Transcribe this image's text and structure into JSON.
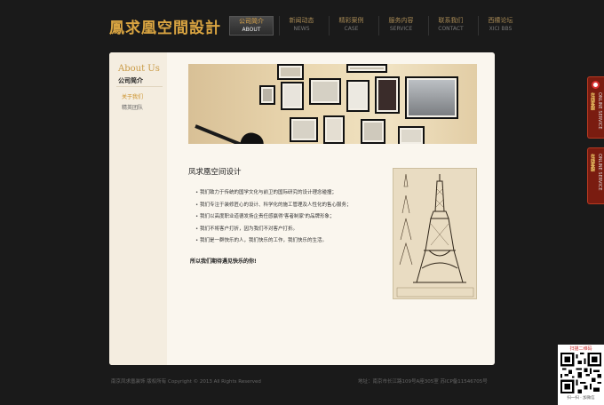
{
  "header": {
    "logo": "鳳求凰空間設計",
    "nav": [
      {
        "cn": "公司简介",
        "en": "ABOUT",
        "active": true
      },
      {
        "cn": "新闻动态",
        "en": "NEWS"
      },
      {
        "cn": "精彩案例",
        "en": "CASE"
      },
      {
        "cn": "服务内容",
        "en": "SERVICE"
      },
      {
        "cn": "联系我们",
        "en": "CONTACT"
      },
      {
        "cn": "西檬论坛",
        "en": "XICI BBS"
      }
    ]
  },
  "sidebar": {
    "title": "About Us",
    "subtitle": "公司简介",
    "links": [
      "关于我们",
      "精英团队"
    ]
  },
  "content": {
    "title": "凤求凰空间设计",
    "bullets": [
      "我们致力于传统的国学文化与前卫的国际研究的设计理念碰撞；",
      "我们专注于装修匠心的设计、科学化的施工管理及人性化的售心服务；",
      "我们以高度职业道德发扬企责任感赢得'客者制家'的品牌形象；",
      "我们不将客户打折，因为我们不对客户打折。",
      "我们是一群快乐的人，我们快乐的工作，我们快乐的生活。"
    ],
    "closing": "所以我们期待遇见快乐的你!"
  },
  "footer": {
    "left": "南京凤求凰装饰 版权所有 Copyright © 2013 All Rights Reserved",
    "right": "地址：南京市长江路109号A座305室  苏ICP备11546705号"
  },
  "service": [
    {
      "cn": "在线客服",
      "en": "ONLINE SERVICE"
    },
    {
      "cn": "在线客服",
      "en": "ONLINE SERVICE"
    }
  ],
  "qr": {
    "top": "扫描二维码",
    "bottom": "扫一扫 · 加微信"
  },
  "colors": {
    "background": "#1a1a1a",
    "accent_gold": "#d9a441",
    "panel": "#faf6ee",
    "service_red": "#7a1c10"
  }
}
